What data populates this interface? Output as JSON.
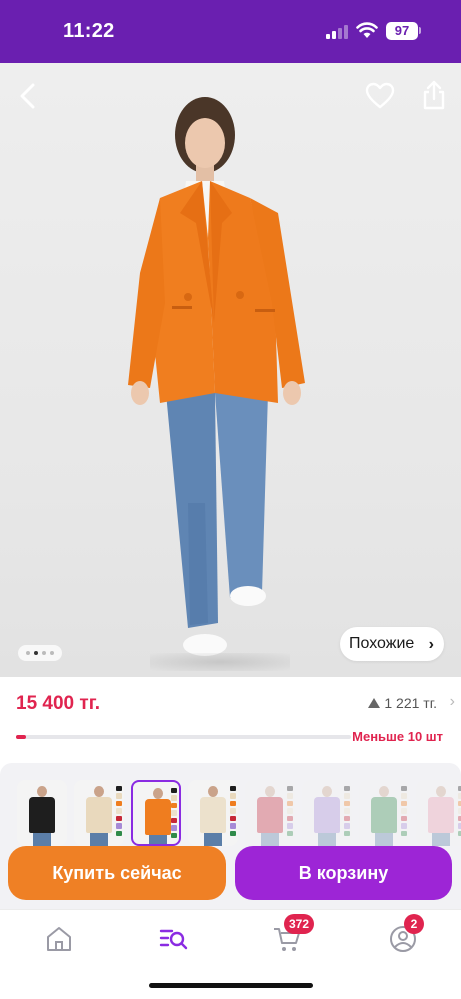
{
  "status_bar": {
    "time": "11:22",
    "battery": "97",
    "background": "#6a1fb0"
  },
  "hero": {
    "back_icon": "chevron-left-icon",
    "favorite_icon": "heart-icon",
    "share_icon": "share-icon",
    "pager": {
      "count": 4,
      "active_index": 1
    },
    "similar_label": "Похожие",
    "similar_icon": "chevron-right-icon"
  },
  "product": {
    "price": "15 400 тг.",
    "rating_count": "1 221 тг.",
    "stock_label": "Меньше 10 шт",
    "stock_fraction": 0.03,
    "accent_color": "#e0244f"
  },
  "thumbnails": [
    {
      "label": "black jacket",
      "body_color": "#1e1e1e",
      "faded": false,
      "selected": false
    },
    {
      "label": "beige jacket",
      "body_color": "#e9d9bd",
      "faded": false,
      "selected": false
    },
    {
      "label": "orange jacket",
      "body_color": "#ef7d1f",
      "faded": false,
      "selected": true
    },
    {
      "label": "cream jacket",
      "body_color": "#ece1cc",
      "faded": false,
      "selected": false
    },
    {
      "label": "red jacket",
      "body_color": "#c62838",
      "faded": true,
      "selected": false
    },
    {
      "label": "lilac jacket",
      "body_color": "#a68ad6",
      "faded": true,
      "selected": false
    },
    {
      "label": "green jacket",
      "body_color": "#2f8a4a",
      "faded": true,
      "selected": false
    },
    {
      "label": "pink jacket",
      "body_color": "#ec9cb0",
      "faded": true,
      "selected": false
    }
  ],
  "actions": {
    "buy_now": "Купить сейчас",
    "add_to_cart": "В корзину",
    "buy_color": "#ef8025",
    "cart_color": "#9d25d6"
  },
  "bottom_nav": {
    "items": [
      {
        "name": "home",
        "icon": "home-icon"
      },
      {
        "name": "catalog",
        "icon": "catalog-search-icon",
        "active": true
      },
      {
        "name": "cart",
        "icon": "cart-icon",
        "badge": "372"
      },
      {
        "name": "profile",
        "icon": "profile-icon",
        "badge": "2"
      }
    ],
    "active_color": "#8a2be2"
  }
}
